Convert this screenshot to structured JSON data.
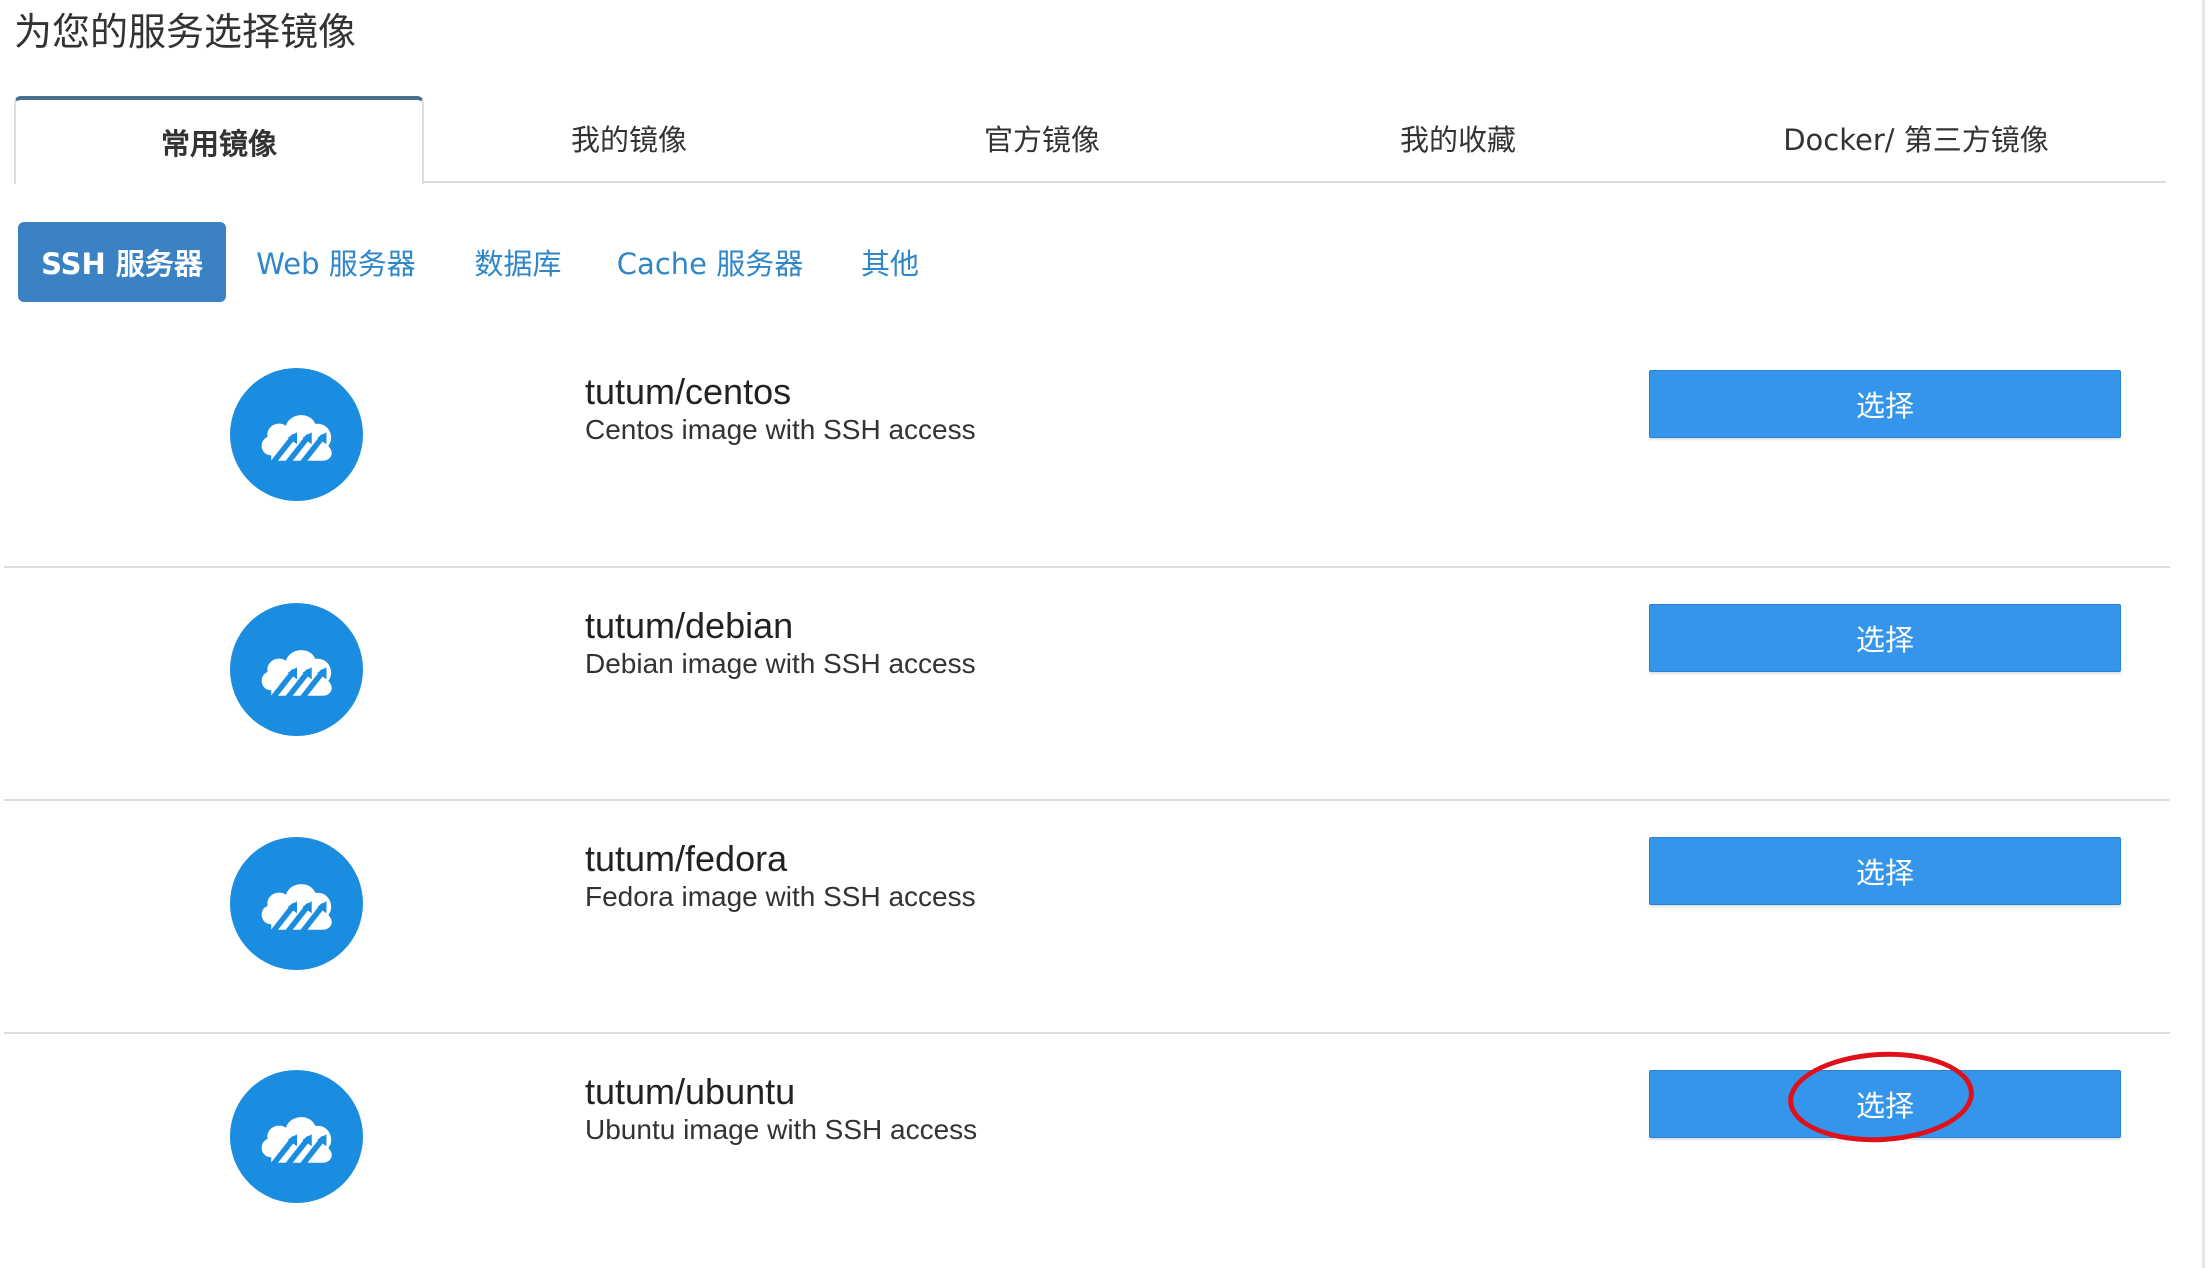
{
  "page": {
    "title": "为您的服务选择镜像"
  },
  "tabs": [
    {
      "label": "常用镜像",
      "active": true
    },
    {
      "label": "我的镜像",
      "active": false
    },
    {
      "label": "官方镜像",
      "active": false
    },
    {
      "label": "我的收藏",
      "active": false
    },
    {
      "label": "Docker/ 第三方镜像",
      "active": false
    }
  ],
  "categories": [
    {
      "label": "SSH 服务器",
      "active": true
    },
    {
      "label": "Web 服务器",
      "active": false
    },
    {
      "label": "数据库",
      "active": false
    },
    {
      "label": "Cache 服务器",
      "active": false
    },
    {
      "label": "其他",
      "active": false
    }
  ],
  "images": [
    {
      "name": "tutum/centos",
      "description": "Centos image with SSH access",
      "button_label": "选择",
      "logo_icon": "tutum-cloud-icon"
    },
    {
      "name": "tutum/debian",
      "description": "Debian image with SSH access",
      "button_label": "选择",
      "logo_icon": "tutum-cloud-icon"
    },
    {
      "name": "tutum/fedora",
      "description": "Fedora image with SSH access",
      "button_label": "选择",
      "logo_icon": "tutum-cloud-icon"
    },
    {
      "name": "tutum/ubuntu",
      "description": "Ubuntu image with SSH access",
      "button_label": "选择",
      "logo_icon": "tutum-cloud-icon",
      "highlighted": true
    }
  ],
  "colors": {
    "accent": "#3595ea",
    "logo": "#1b8de0",
    "pill_active": "#3b82c4",
    "link": "#2f86c9",
    "annotation": "#e0101b"
  }
}
